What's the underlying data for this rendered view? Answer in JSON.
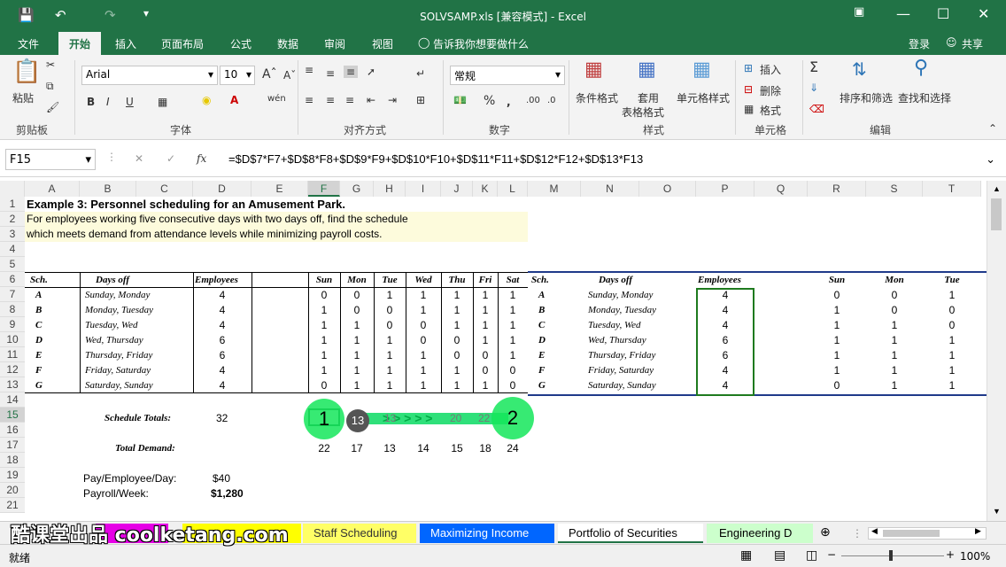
{
  "title_bar": {
    "title": "SOLVSAMP.xls  [兼容模式] - Excel",
    "save_icon": "save-icon",
    "undo_icon": "undo-icon",
    "redo_icon": "redo-icon"
  },
  "menu": {
    "tabs": [
      "文件",
      "开始",
      "插入",
      "页面布局",
      "公式",
      "数据",
      "审阅",
      "视图"
    ],
    "tell": "告诉我你想要做什么",
    "login": "登录",
    "share": "共享"
  },
  "ribbon": {
    "paste": "粘贴",
    "clipboard": "剪贴板",
    "font_name": "Arial",
    "font_size": "10",
    "font_group": "字体",
    "align_group": "对齐方式",
    "number_format": "常规",
    "number_group": "数字",
    "cond_format": "条件格式",
    "table_format_1": "套用",
    "table_format_2": "表格格式",
    "cell_style": "单元格样式",
    "style_group": "样式",
    "insert": "插入",
    "delete": "删除",
    "format": "格式",
    "cells_group": "单元格",
    "sort": "排序和筛选",
    "find": "查找和选择",
    "edit_group": "编辑"
  },
  "formula_bar": {
    "name_box": "F15",
    "formula": "=$D$7*F7+$D$8*F8+$D$9*F9+$D$10*F10+$D$11*F11+$D$12*F12+$D$13*F13"
  },
  "columns": [
    "A",
    "B",
    "C",
    "D",
    "E",
    "F",
    "G",
    "H",
    "I",
    "J",
    "K",
    "L",
    "M",
    "N",
    "O",
    "P",
    "Q",
    "R",
    "S",
    "T"
  ],
  "rows": [
    "1",
    "2",
    "3",
    "4",
    "5",
    "6",
    "7",
    "8",
    "9",
    "10",
    "11",
    "12",
    "13",
    "14",
    "15",
    "16",
    "17",
    "18",
    "19",
    "20",
    "21"
  ],
  "sheet": {
    "title": "Example 3:  Personnel scheduling for an Amusement Park.",
    "desc1": "For employees working five consecutive days with two days off, find the schedule",
    "desc2": "which meets demand from attendance levels while minimizing payroll costs.",
    "hdr": {
      "sch": "Sch.",
      "days_off": "Days off",
      "employees": "Employees",
      "days": [
        "Sun",
        "Mon",
        "Tue",
        "Wed",
        "Thu",
        "Fri",
        "Sat"
      ]
    },
    "table": [
      {
        "sch": "A",
        "off": "Sunday, Monday",
        "emp": "4",
        "v": [
          "0",
          "0",
          "1",
          "1",
          "1",
          "1",
          "1"
        ]
      },
      {
        "sch": "B",
        "off": "Monday, Tuesday",
        "emp": "4",
        "v": [
          "1",
          "0",
          "0",
          "1",
          "1",
          "1",
          "1"
        ]
      },
      {
        "sch": "C",
        "off": "Tuesday, Wed",
        "emp": "4",
        "v": [
          "1",
          "1",
          "0",
          "0",
          "1",
          "1",
          "1"
        ]
      },
      {
        "sch": "D",
        "off": "Wed, Thursday",
        "emp": "6",
        "v": [
          "1",
          "1",
          "1",
          "0",
          "0",
          "1",
          "1"
        ]
      },
      {
        "sch": "E",
        "off": "Thursday, Friday",
        "emp": "6",
        "v": [
          "1",
          "1",
          "1",
          "1",
          "0",
          "0",
          "1"
        ]
      },
      {
        "sch": "F",
        "off": "Friday, Saturday",
        "emp": "4",
        "v": [
          "1",
          "1",
          "1",
          "1",
          "1",
          "0",
          "0"
        ]
      },
      {
        "sch": "G",
        "off": "Saturday, Sunday",
        "emp": "4",
        "v": [
          "0",
          "1",
          "1",
          "1",
          "1",
          "1",
          "0"
        ]
      }
    ],
    "right_hdr": {
      "days": [
        "Sun",
        "Mon",
        "Tue"
      ]
    },
    "right": [
      [
        "0",
        "0",
        "1"
      ],
      [
        "1",
        "0",
        "0"
      ],
      [
        "1",
        "1",
        "0"
      ],
      [
        "1",
        "1",
        "1"
      ],
      [
        "1",
        "1",
        "1"
      ],
      [
        "1",
        "1",
        "1"
      ],
      [
        "0",
        "1",
        "1"
      ]
    ],
    "schedule_totals_label": "Schedule Totals:",
    "schedule_totals": "32",
    "totals_row": [
      "13",
      "20",
      "22"
    ],
    "total_demand_label": "Total Demand:",
    "demand": [
      "22",
      "17",
      "13",
      "14",
      "15",
      "18",
      "24"
    ],
    "pay_label": "Pay/Employee/Day:",
    "pay": "$40",
    "payroll_label": "Payroll/Week:",
    "payroll": "$1,280"
  },
  "overlay": {
    "marker1": "1",
    "marker2": "2",
    "arrows": "> > > > >"
  },
  "tabs": [
    "Staff Scheduling",
    "Maximizing Income",
    "Portfolio of Securities",
    "Engineering D ..."
  ],
  "status": {
    "ready": "就绪",
    "zoom": "100%"
  },
  "watermark": "酷课堂出品 coolketang.com"
}
